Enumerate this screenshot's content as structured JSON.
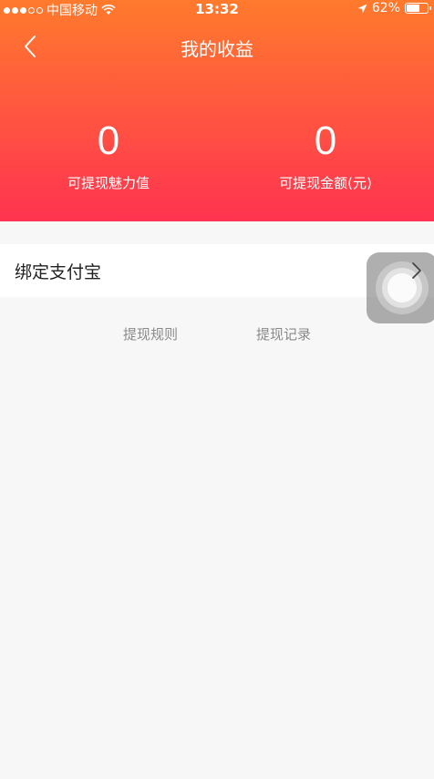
{
  "status_bar": {
    "carrier": "中国移动",
    "time": "13:32",
    "battery": "62%",
    "battery_level": 0.62
  },
  "header": {
    "title": "我的收益",
    "stats": [
      {
        "value": "0",
        "label": "可提现魅力值"
      },
      {
        "value": "0",
        "label": "可提现金额(元)"
      }
    ]
  },
  "alipay": {
    "label": "绑定支付宝"
  },
  "links": {
    "rules": "提现规则",
    "records": "提现记录"
  }
}
